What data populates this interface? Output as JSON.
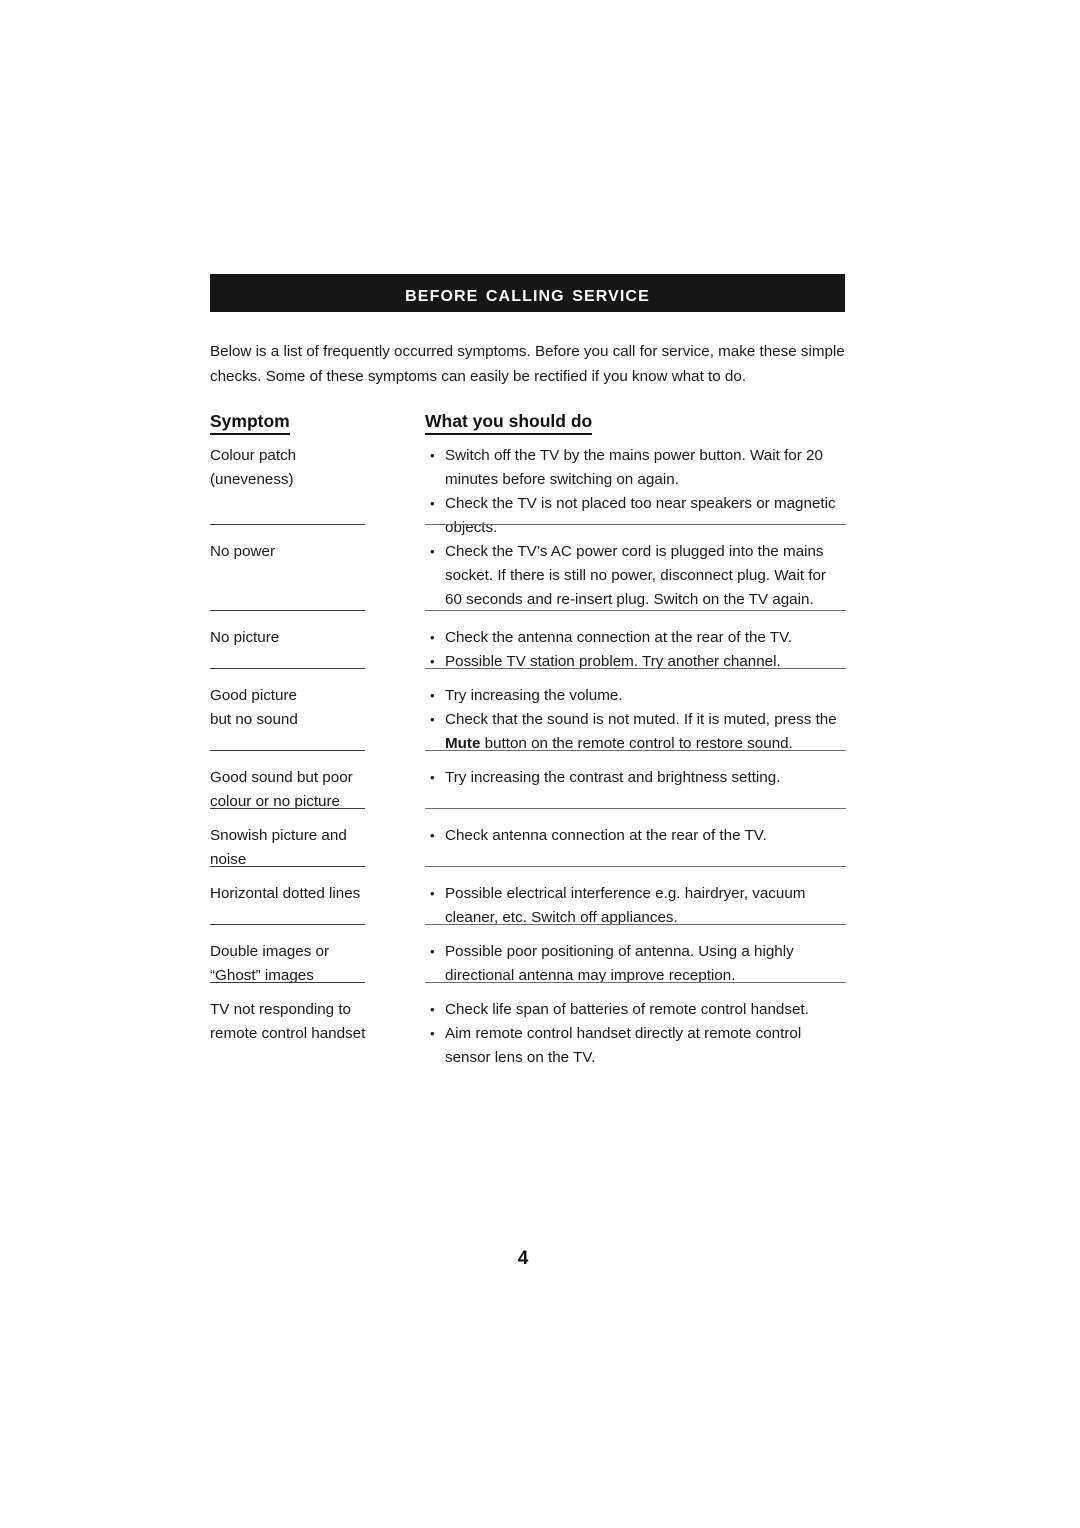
{
  "document": {
    "section_title": "Before Calling Service",
    "intro": "Below is a list of frequently occurred symptoms. Before you call for service, make these simple checks. Some of these symptoms can easily be rectified if you know what to do.",
    "page_number": "4",
    "colors": {
      "title_bar_background": "#161616",
      "title_bar_text": "#ffffff",
      "body_text": "#1a1a1a",
      "rule_left": "#3a3a3a",
      "rule_right": "#6e6e72",
      "page_background": "#ffffff"
    },
    "table": {
      "headers": {
        "symptom": "Symptom",
        "action": "What you should do"
      },
      "bullet_glyph": "•",
      "rows": [
        {
          "symptom": "Colour patch\n(uneveness)",
          "actions": [
            {
              "text": "Switch off the TV by the mains power button. Wait for 20 minutes before switching on again."
            },
            {
              "text": "Check the TV is not placed too near speakers or magnetic objects."
            }
          ]
        },
        {
          "symptom": "No power",
          "actions": [
            {
              "text": "Check the TV’s AC power cord is plugged into the mains socket. If there is still no power, disconnect plug. Wait for 60 seconds and re-insert plug. Switch on the TV again."
            }
          ]
        },
        {
          "symptom": "No picture",
          "actions": [
            {
              "text": "Check the antenna connection at the rear of the TV."
            },
            {
              "text": "Possible TV station problem. Try another channel."
            }
          ]
        },
        {
          "symptom": "Good picture\nbut no sound",
          "actions": [
            {
              "text": "Try increasing the volume."
            },
            {
              "text_before": "Check that the sound is not muted. If it is muted, press the ",
              "bold": "Mute",
              "text_after": " button on the remote control to restore sound."
            }
          ]
        },
        {
          "symptom": "Good sound but poor\ncolour or no picture",
          "actions": [
            {
              "text": "Try increasing the contrast and brightness setting."
            }
          ]
        },
        {
          "symptom": "Snowish picture and\nnoise",
          "actions": [
            {
              "text": "Check antenna connection at the rear of the TV."
            }
          ]
        },
        {
          "symptom": "Horizontal dotted lines",
          "actions": [
            {
              "text": "Possible electrical interference e.g. hairdryer, vacuum cleaner, etc. Switch off appliances."
            }
          ]
        },
        {
          "symptom": "Double images or\n“Ghost” images",
          "actions": [
            {
              "text": "Possible poor positioning of antenna. Using a highly directional  antenna may improve reception."
            }
          ]
        },
        {
          "symptom": "TV not responding to\nremote control handset",
          "actions": [
            {
              "text": "Check life span of batteries of remote control handset."
            },
            {
              "text": "Aim remote control handset directly at remote control sensor lens on the TV."
            }
          ]
        }
      ]
    }
  }
}
